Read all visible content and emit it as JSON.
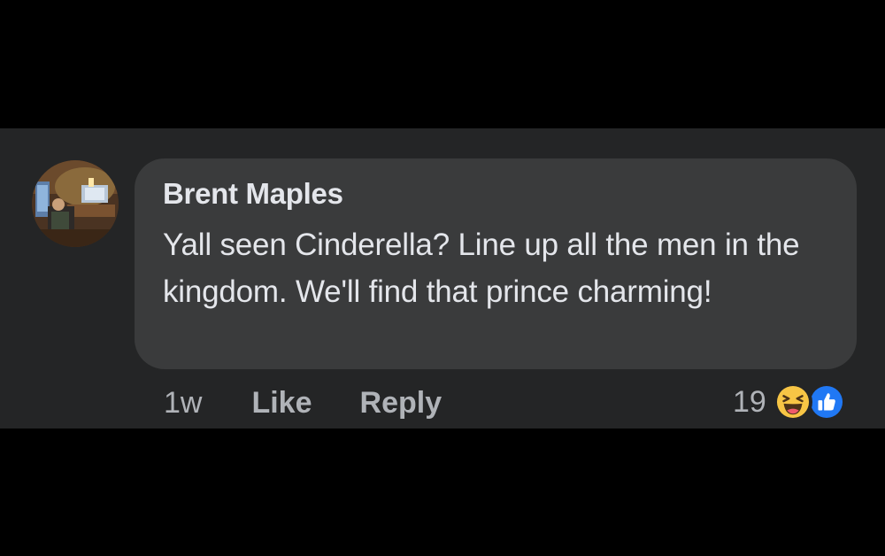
{
  "comment": {
    "author": "Brent Maples",
    "text": "Yall seen Cinderella? Line up all the men in the kingdom. We'll find that prince charming!",
    "time": "1w",
    "actions": {
      "like_label": "Like",
      "reply_label": "Reply"
    },
    "reactions": {
      "count": "19",
      "icons": [
        "haha-icon",
        "like-icon"
      ]
    },
    "avatar": "profile-photo"
  },
  "colors": {
    "page_bg": "#000000",
    "panel_bg": "#242526",
    "bubble_bg": "#3a3b3c",
    "primary_text": "#e4e6eb",
    "secondary_text": "#b0b3b8",
    "like_blue": "#2078f4",
    "haha_yellow": "#f7c545"
  }
}
